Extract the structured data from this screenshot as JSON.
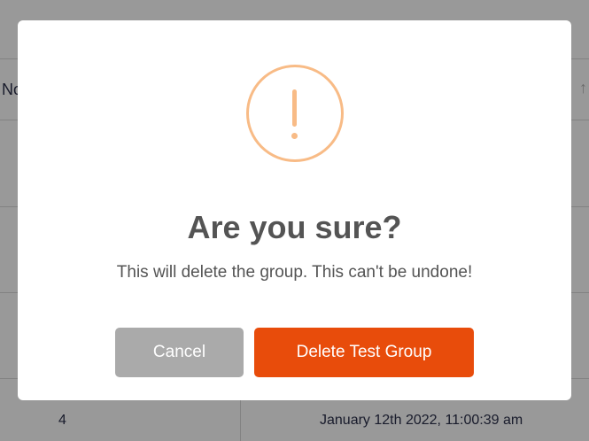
{
  "background_table": {
    "header_no_label": "No",
    "sort_icon": "sort-arrow-up-icon",
    "last_row": {
      "number": "4",
      "date": "January 12th 2022, 11:00:39 am"
    }
  },
  "dialog": {
    "icon": "warning-icon",
    "title": "Are you sure?",
    "text": "This will delete the group. This can't be undone!",
    "cancel_label": "Cancel",
    "confirm_label": "Delete Test Group"
  },
  "colors": {
    "warning": "#f8bb86",
    "confirm": "#e84c0b",
    "cancel": "#aaaaaa",
    "text": "#545454"
  }
}
